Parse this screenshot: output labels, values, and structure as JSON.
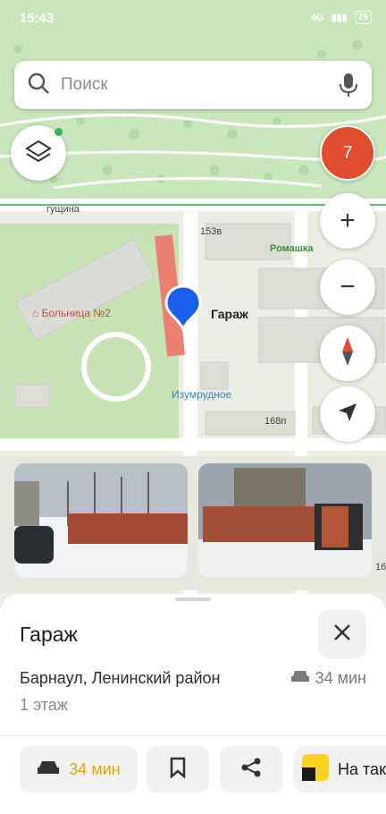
{
  "status_bar": {
    "time": "15:43",
    "network": "4G",
    "battery": "75"
  },
  "search": {
    "placeholder": "Поиск"
  },
  "map": {
    "cluster_count": "7",
    "street_label": "гущина",
    "house_153v": "153в",
    "shop_label": "Ромашка",
    "hospital_label": "Больница №2",
    "pin_label": "Гараж",
    "stop_label": "Изумрудное",
    "house_168p": "168п",
    "edge_number": "16"
  },
  "place": {
    "title": "Гараж",
    "address": "Барнаул, Ленинский район",
    "drive_time": "34 мин",
    "floor": "1 этаж"
  },
  "actions": {
    "route_time": "34 мин",
    "taxi_label": "На такси"
  },
  "colors": {
    "pin": "#1a5ef0",
    "cluster": "#e14b2e",
    "route_accent": "#e6a600",
    "taxi_yellow": "#ffd21e"
  }
}
